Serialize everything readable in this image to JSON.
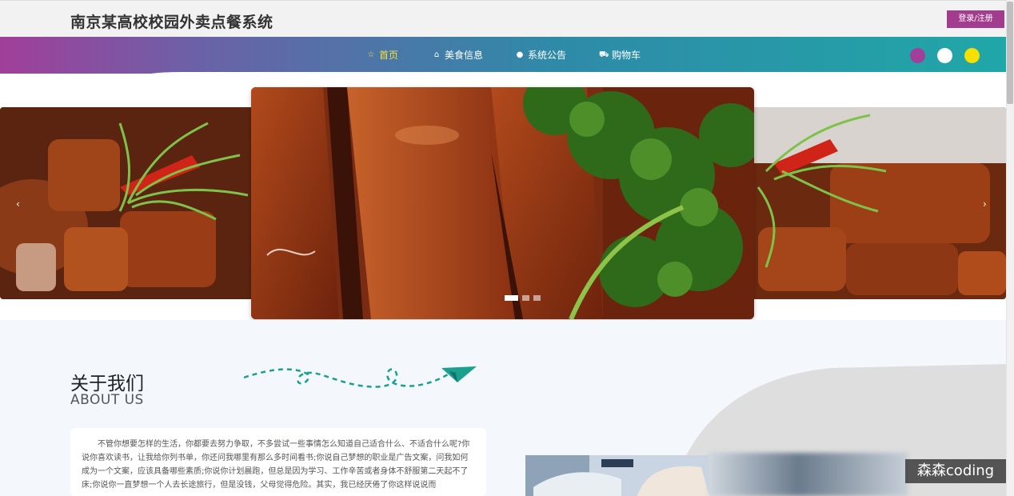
{
  "header": {
    "site_title": "南京某高校校园外卖点餐系统",
    "login_label": "登录/注册"
  },
  "nav": {
    "items": [
      {
        "label": "首页",
        "icon": "star-icon",
        "active": true
      },
      {
        "label": "美食信息",
        "icon": "home-icon",
        "active": false
      },
      {
        "label": "系统公告",
        "icon": "info-icon",
        "active": false
      },
      {
        "label": "购物车",
        "icon": "cart-icon",
        "active": false
      }
    ],
    "theme_colors": [
      "#a13f9a",
      "#ffffff",
      "#f5e000"
    ]
  },
  "carousel": {
    "prev_glyph": "‹",
    "next_glyph": "›",
    "active_index": 0,
    "slide_count": 3
  },
  "about": {
    "title_cn": "关于我们",
    "title_en": "ABOUT US",
    "text": "不管你想要怎样的生活，你都要去努力争取，不多尝试一些事情怎么知道自己适合什么、不适合什么呢?你说你喜欢读书，让我给你列书单，你还问我哪里有那么多时间看书;你说自己梦想的职业是广告文案，问我如何成为一个文案，应该具备哪些素质;你说你计划晨跑，但总是因为学习、工作辛苦或者身体不舒服第二天起不了床;你说你一直梦想一个人去长途旅行，但是没钱，父母觉得危险。其实，我已经厌倦了你这样说说而"
  },
  "watermark": "森森coding",
  "colors": {
    "accent_purple": "#a23c8e",
    "nav_teal": "#20a7a8",
    "active_yellow": "#f5e13a"
  }
}
